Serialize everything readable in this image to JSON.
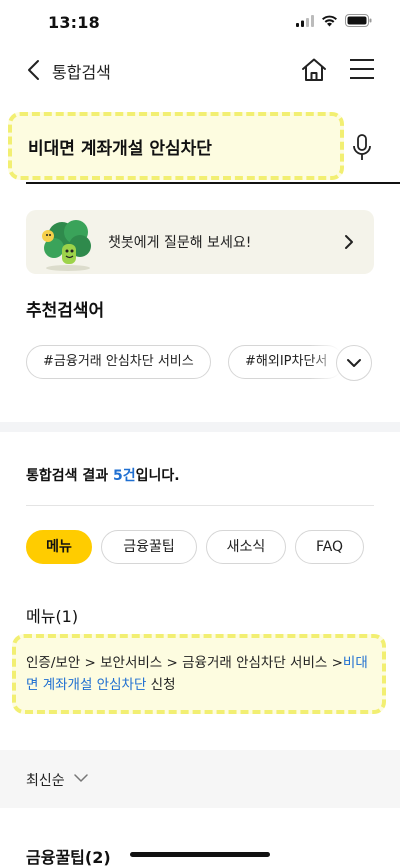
{
  "status_bar": {
    "time": "13:18"
  },
  "header": {
    "title": "통합검색"
  },
  "search": {
    "query": "비대면 계좌개설 안심차단"
  },
  "chatbot": {
    "text": "챗봇에게 질문해 보세요!"
  },
  "recommended": {
    "title": "추천검색어",
    "tags": [
      "#금융거래 안심차단 서비스",
      "#해외IP차단서"
    ]
  },
  "results": {
    "summary_prefix": "통합검색 결과 ",
    "summary_count": "5건",
    "summary_suffix": "입니다."
  },
  "filters": [
    "메뉴",
    "금융꿀팁",
    "새소식",
    "FAQ"
  ],
  "menu_section": {
    "title": "메뉴(1)",
    "path": "인증/보안 > 보안서비스 > 금융거래 안심차단 서비스 >",
    "link": "비대면 계좌개설 안심차단",
    "suffix": " 신청"
  },
  "sort": {
    "label": "최신순"
  },
  "tips_section": {
    "title": "금융꿀팁(2)"
  },
  "colors": {
    "accent": "#ffcc00",
    "link": "#1f6fd1",
    "highlight": "#e8e300"
  },
  "icons": [
    "signal-icon",
    "wifi-icon",
    "battery-icon",
    "back-arrow-icon",
    "home-icon",
    "hamburger-icon",
    "mic-icon",
    "chatbot-character-icon",
    "chevron-right-icon",
    "chevron-down-icon"
  ]
}
